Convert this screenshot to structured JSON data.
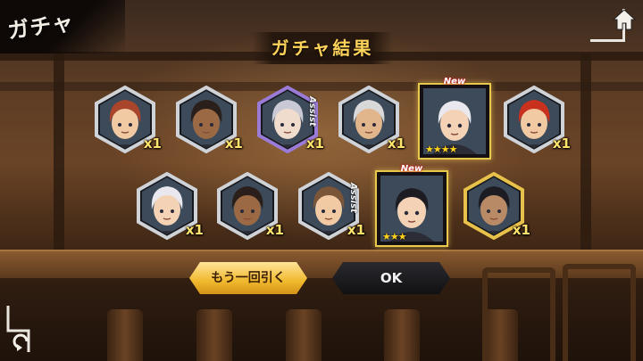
{
  "header": {
    "corner_title": "ガチャ",
    "result_title": "ガチャ結果"
  },
  "icons": {
    "home": "home-icon",
    "back": "return-arrow-icon"
  },
  "colors": {
    "gold": "#ffd35a",
    "count": "#ffe36b",
    "star": "#ffd21e",
    "new": "#c0202a"
  },
  "cards_row1": [
    {
      "count": "x1",
      "assist": "",
      "hair": "#a8452b",
      "skin": "#f1c9a2",
      "frame": "silver"
    },
    {
      "count": "x1",
      "assist": "",
      "hair": "#2a1f1a",
      "skin": "#9b6a45",
      "frame": "silver"
    },
    {
      "count": "x1",
      "assist": "Assist",
      "hair": "#c9c9d6",
      "skin": "#f0dccd",
      "frame": "prism"
    },
    {
      "count": "x1",
      "assist": "",
      "hair": "#d8d8d8",
      "skin": "#e2b68c",
      "frame": "silver"
    },
    {
      "new": "New",
      "stars": "★★★★",
      "hair": "#e8e8ee",
      "skin": "#f3d2b6",
      "rare": true
    },
    {
      "count": "x1",
      "assist": "",
      "hair": "#c8311e",
      "skin": "#f1c9a2",
      "frame": "silver"
    }
  ],
  "cards_row2": [
    {
      "count": "x1",
      "assist": "",
      "hair": "#e8e8ee",
      "skin": "#f3d2b6",
      "frame": "silver"
    },
    {
      "count": "x1",
      "assist": "",
      "hair": "#2a1f1a",
      "skin": "#9b6a45",
      "frame": "silver"
    },
    {
      "count": "x1",
      "assist": "Assist",
      "hair": "#7a5537",
      "skin": "#f1c9a2",
      "frame": "silver"
    },
    {
      "new": "New",
      "stars": "★★★",
      "hair": "#1c1c22",
      "skin": "#f3d2b6",
      "rare": true
    },
    {
      "count": "x1",
      "assist": "",
      "hair": "#1c1c22",
      "skin": "#b98a66",
      "frame": "gold"
    }
  ],
  "buttons": {
    "again": "もう一回引く",
    "ok": "OK"
  }
}
